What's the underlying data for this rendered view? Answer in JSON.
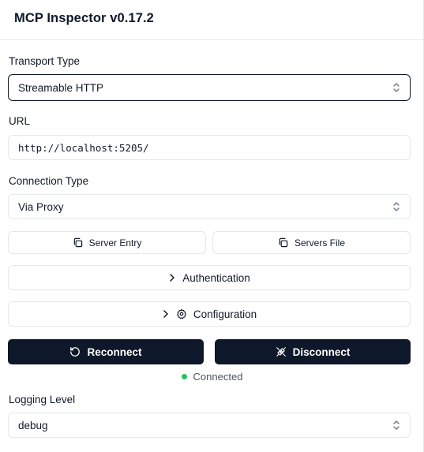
{
  "header": {
    "title": "MCP Inspector v0.17.2"
  },
  "transport": {
    "label": "Transport Type",
    "value": "Streamable HTTP"
  },
  "url": {
    "label": "URL",
    "value": "http://localhost:5205/"
  },
  "connection": {
    "label": "Connection Type",
    "value": "Via Proxy"
  },
  "entries": {
    "server_entry": "Server Entry",
    "servers_file": "Servers File"
  },
  "sections": {
    "authentication": "Authentication",
    "configuration": "Configuration"
  },
  "actions": {
    "reconnect": "Reconnect",
    "disconnect": "Disconnect"
  },
  "status": {
    "text": "Connected",
    "color": "#22c55e"
  },
  "logging": {
    "label": "Logging Level",
    "value": "debug"
  },
  "colors": {
    "primary_dark": "#0f172a",
    "border": "#e5e7eb"
  },
  "icons": {
    "select": "chevron-up-down-icon",
    "copy": "copy-icon",
    "expand": "chevron-right-icon",
    "settings": "gear-icon",
    "reconnect": "rotate-ccw-icon",
    "disconnect": "unplug-icon"
  }
}
